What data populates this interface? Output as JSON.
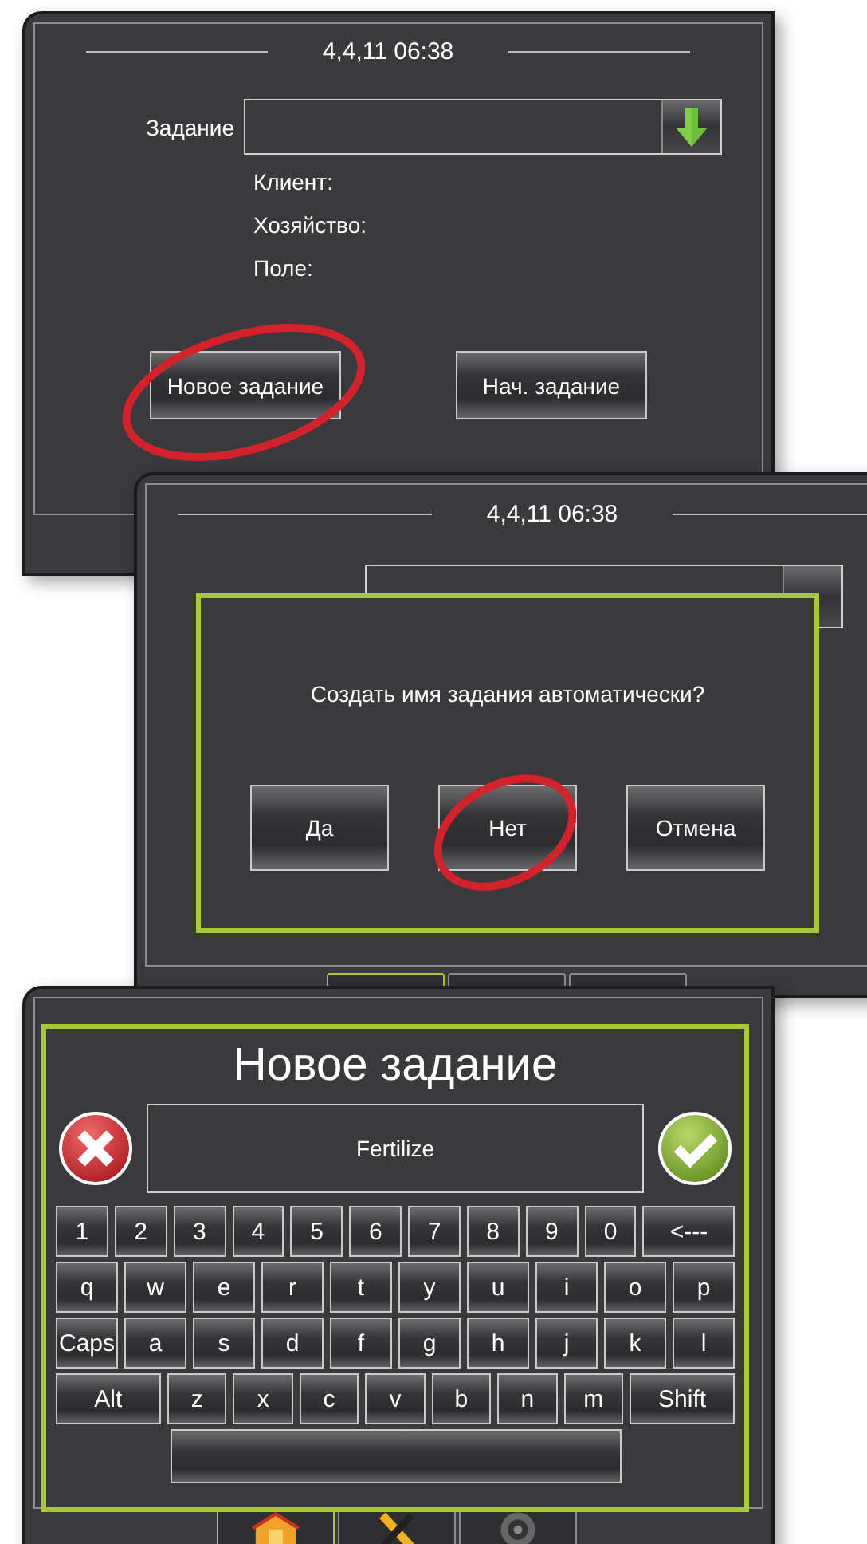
{
  "job_screen": {
    "datetime": "4,4,11 06:38",
    "job_label": "Задание",
    "info_labels": [
      "Клиент:",
      "Хозяйство:",
      "Поле:"
    ],
    "buttons": [
      {
        "label": "Новое задание",
        "highlighted": true
      },
      {
        "label": "Нач. задание",
        "highlighted": false
      }
    ]
  },
  "confirm_screen": {
    "datetime": "4,4,11 06:38",
    "dialog": {
      "message": "Создать имя задания автоматически?",
      "buttons": [
        {
          "label": "Да",
          "highlighted": false
        },
        {
          "label": "Нет",
          "highlighted": true
        },
        {
          "label": "Отмена",
          "highlighted": false
        }
      ]
    },
    "tabs": [
      {
        "selected": true
      },
      {
        "selected": false
      },
      {
        "selected": false
      }
    ]
  },
  "keyboard_screen": {
    "title": "Новое задание",
    "name_field": {
      "value": "Fertilize"
    },
    "keys": [
      [
        {
          "label": "1",
          "kind": "char"
        },
        {
          "label": "2",
          "kind": "char"
        },
        {
          "label": "3",
          "kind": "char"
        },
        {
          "label": "4",
          "kind": "char"
        },
        {
          "label": "5",
          "kind": "char"
        },
        {
          "label": "6",
          "kind": "char"
        },
        {
          "label": "7",
          "kind": "char"
        },
        {
          "label": "8",
          "kind": "char"
        },
        {
          "label": "9",
          "kind": "char"
        },
        {
          "label": "0",
          "kind": "char"
        },
        {
          "label": "<---",
          "kind": "wide"
        }
      ],
      [
        {
          "label": "q",
          "kind": "char"
        },
        {
          "label": "w",
          "kind": "char"
        },
        {
          "label": "e",
          "kind": "char"
        },
        {
          "label": "r",
          "kind": "char"
        },
        {
          "label": "t",
          "kind": "char"
        },
        {
          "label": "y",
          "kind": "char"
        },
        {
          "label": "u",
          "kind": "char"
        },
        {
          "label": "i",
          "kind": "char"
        },
        {
          "label": "o",
          "kind": "char"
        },
        {
          "label": "p",
          "kind": "char"
        }
      ],
      [
        {
          "label": "Caps",
          "kind": "char"
        },
        {
          "label": "a",
          "kind": "char"
        },
        {
          "label": "s",
          "kind": "char"
        },
        {
          "label": "d",
          "kind": "char"
        },
        {
          "label": "f",
          "kind": "char"
        },
        {
          "label": "g",
          "kind": "char"
        },
        {
          "label": "h",
          "kind": "char"
        },
        {
          "label": "j",
          "kind": "char"
        },
        {
          "label": "k",
          "kind": "char"
        },
        {
          "label": "l",
          "kind": "char"
        }
      ],
      [
        {
          "label": "Alt",
          "kind": "wide"
        },
        {
          "label": "z",
          "kind": "char"
        },
        {
          "label": "x",
          "kind": "char"
        },
        {
          "label": "c",
          "kind": "char"
        },
        {
          "label": "v",
          "kind": "char"
        },
        {
          "label": "b",
          "kind": "char"
        },
        {
          "label": "n",
          "kind": "char"
        },
        {
          "label": "m",
          "kind": "char"
        },
        {
          "label": "Shift",
          "kind": "wide"
        }
      ],
      [
        {
          "kind": "space"
        }
      ]
    ],
    "tabs": [
      {
        "selected": true
      },
      {
        "selected": false
      },
      {
        "selected": false
      }
    ]
  }
}
